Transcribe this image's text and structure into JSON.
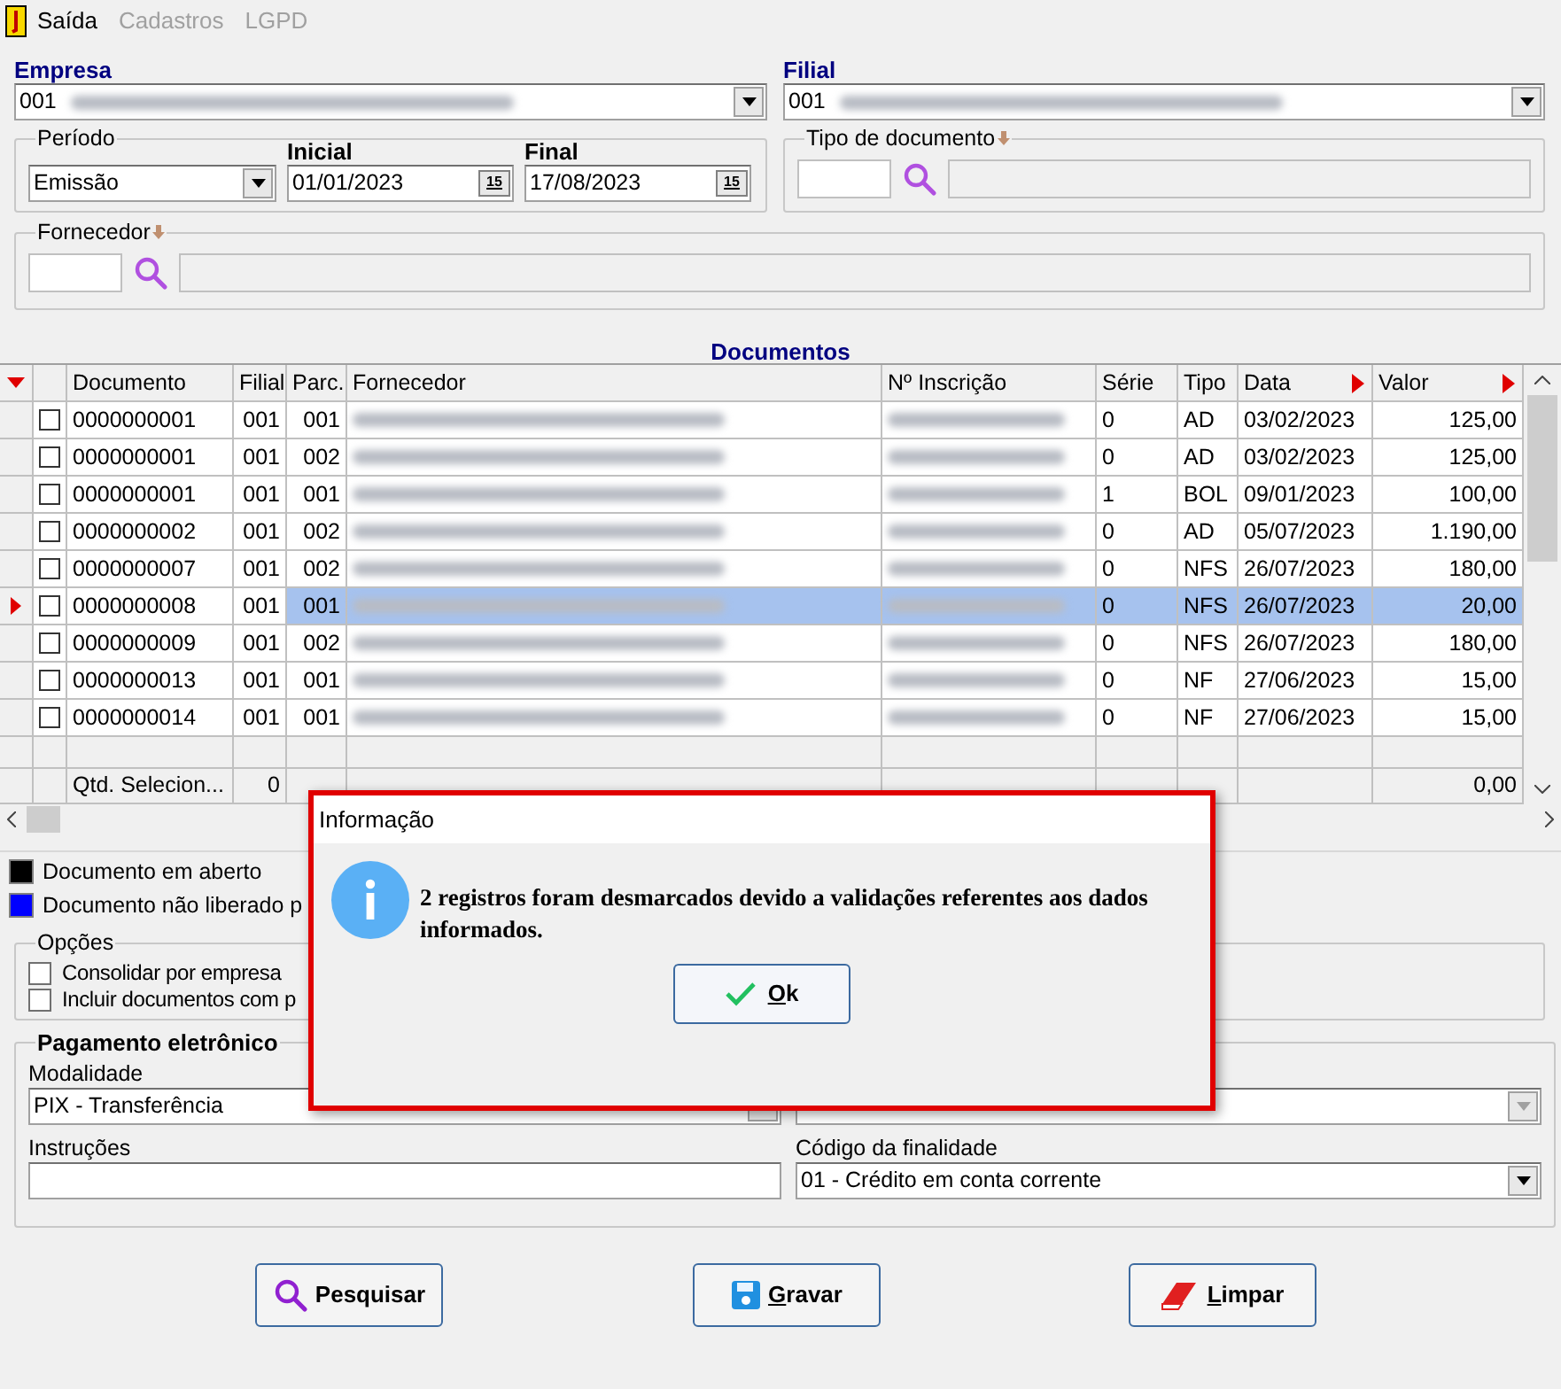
{
  "menu": [
    {
      "label": "Saída",
      "disabled": false
    },
    {
      "label": "Cadastros",
      "disabled": true
    },
    {
      "label": "LGPD",
      "disabled": true
    }
  ],
  "empresa": {
    "label": "Empresa",
    "code": "001"
  },
  "filial": {
    "label": "Filial",
    "code": "001"
  },
  "periodo": {
    "legend": "Período",
    "type": "Emissão",
    "dates": [
      {
        "label": "Inicial",
        "value": "01/01/2023",
        "calendar_button": "15"
      },
      {
        "label": "Final",
        "value": "17/08/2023",
        "calendar_button": "15"
      }
    ]
  },
  "tipo_documento": {
    "legend": "Tipo de documento"
  },
  "fornecedor": {
    "legend": "Fornecedor"
  },
  "documentos": {
    "title": "Documentos",
    "columns": [
      {
        "label": "Documento",
        "sorted": false
      },
      {
        "label": "Filial",
        "sorted": false
      },
      {
        "label": "Parc.",
        "sorted": false
      },
      {
        "label": "Fornecedor",
        "sorted": false
      },
      {
        "label": "Nº Inscrição",
        "sorted": false
      },
      {
        "label": "Série",
        "sorted": false
      },
      {
        "label": "Tipo",
        "sorted": false
      },
      {
        "label": "Data",
        "sorted": true
      },
      {
        "label": "Valor",
        "sorted": true
      }
    ],
    "rows": [
      {
        "selected": false,
        "checked": false,
        "documento": "0000000001",
        "filial": "001",
        "parc": "001",
        "serie": "0",
        "tipo": "AD",
        "data": "03/02/2023",
        "valor": "125,00"
      },
      {
        "selected": false,
        "checked": false,
        "documento": "0000000001",
        "filial": "001",
        "parc": "002",
        "serie": "0",
        "tipo": "AD",
        "data": "03/02/2023",
        "valor": "125,00"
      },
      {
        "selected": false,
        "checked": false,
        "documento": "0000000001",
        "filial": "001",
        "parc": "001",
        "serie": "1",
        "tipo": "BOL",
        "data": "09/01/2023",
        "valor": "100,00"
      },
      {
        "selected": false,
        "checked": false,
        "documento": "0000000002",
        "filial": "001",
        "parc": "002",
        "serie": "0",
        "tipo": "AD",
        "data": "05/07/2023",
        "valor": "1.190,00"
      },
      {
        "selected": false,
        "checked": false,
        "documento": "0000000007",
        "filial": "001",
        "parc": "002",
        "serie": "0",
        "tipo": "NFS",
        "data": "26/07/2023",
        "valor": "180,00"
      },
      {
        "selected": true,
        "checked": false,
        "documento": "0000000008",
        "filial": "001",
        "parc": "001",
        "serie": "0",
        "tipo": "NFS",
        "data": "26/07/2023",
        "valor": "20,00"
      },
      {
        "selected": false,
        "checked": false,
        "documento": "0000000009",
        "filial": "001",
        "parc": "002",
        "serie": "0",
        "tipo": "NFS",
        "data": "26/07/2023",
        "valor": "180,00"
      },
      {
        "selected": false,
        "checked": false,
        "documento": "0000000013",
        "filial": "001",
        "parc": "001",
        "serie": "0",
        "tipo": "NF",
        "data": "27/06/2023",
        "valor": "15,00"
      },
      {
        "selected": false,
        "checked": false,
        "documento": "0000000014",
        "filial": "001",
        "parc": "001",
        "serie": "0",
        "tipo": "NF",
        "data": "27/06/2023",
        "valor": "15,00"
      }
    ],
    "footer": {
      "label": "Qtd. Selecion...",
      "count": "0",
      "total": "0,00"
    }
  },
  "legend": [
    {
      "label": "Documento em aberto",
      "color": "#000000"
    },
    {
      "label": "Documento não liberado p",
      "color": "#0000ff"
    }
  ],
  "opcoes": {
    "legend": "Opções",
    "items": [
      {
        "label": "Consolidar por empresa",
        "checked": false
      },
      {
        "label": "Incluir documentos com p",
        "checked": false
      }
    ]
  },
  "pagamento": {
    "legend": "Pagamento eletrônico",
    "modalidade_label": "Modalidade",
    "modalidade": "PIX - Transferência",
    "instrucoes_label": "Instruções",
    "finalidade_label": "Código da finalidade",
    "finalidade": "01 - Crédito em conta corrente"
  },
  "buttons": [
    {
      "label": "Pesquisar",
      "kind": "search",
      "accelerator": false
    },
    {
      "label": "Gravar",
      "kind": "save",
      "accelerator": true
    },
    {
      "label": "Limpar",
      "kind": "clear",
      "accelerator": true
    }
  ],
  "dialog": {
    "title": "Informação",
    "message": "2 registros foram desmarcados devido a validações referentes aos dados informados.",
    "button": "Ok",
    "accelerator": true
  }
}
